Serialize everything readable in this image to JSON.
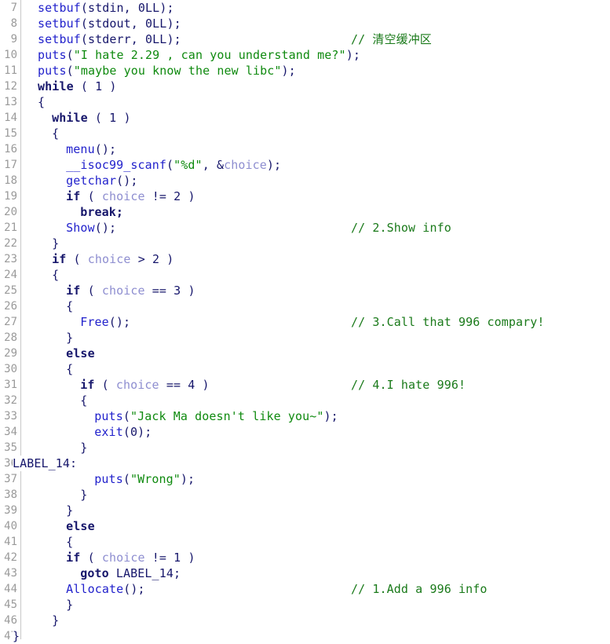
{
  "editor": {
    "kind": "decompiler-pseudocode-view",
    "language": "c",
    "first_line_number": 7,
    "last_line_number": 47,
    "gutter_separator_color": "#c8c8c8",
    "background_color": "#ffffff"
  },
  "colors": {
    "keyword": "#16166b",
    "function": "#2222cc",
    "variable": "#8e8ed0",
    "string": "#0f8a0f",
    "comment": "#1a7a1a",
    "line_number": "#9a9a9a",
    "punctuation": "#16166b"
  },
  "lines": [
    {
      "no": "7",
      "indent": 2,
      "comment": "",
      "tokens": [
        {
          "t": "setbuf",
          "c": "fn"
        },
        {
          "t": "(",
          "c": "punc"
        },
        {
          "t": "stdin",
          "c": "plain"
        },
        {
          "t": ", ",
          "c": "punc"
        },
        {
          "t": "0LL",
          "c": "num"
        },
        {
          "t": ");",
          "c": "punc"
        }
      ]
    },
    {
      "no": "8",
      "indent": 2,
      "comment": "",
      "tokens": [
        {
          "t": "setbuf",
          "c": "fn"
        },
        {
          "t": "(",
          "c": "punc"
        },
        {
          "t": "stdout",
          "c": "plain"
        },
        {
          "t": ", ",
          "c": "punc"
        },
        {
          "t": "0LL",
          "c": "num"
        },
        {
          "t": ");",
          "c": "punc"
        }
      ]
    },
    {
      "no": "9",
      "indent": 2,
      "comment": "// 清空缓冲区",
      "tokens": [
        {
          "t": "setbuf",
          "c": "fn"
        },
        {
          "t": "(",
          "c": "punc"
        },
        {
          "t": "stderr",
          "c": "plain"
        },
        {
          "t": ", ",
          "c": "punc"
        },
        {
          "t": "0LL",
          "c": "num"
        },
        {
          "t": ");",
          "c": "punc"
        }
      ]
    },
    {
      "no": "10",
      "indent": 2,
      "comment": "",
      "tokens": [
        {
          "t": "puts",
          "c": "fn"
        },
        {
          "t": "(",
          "c": "punc"
        },
        {
          "t": "\"I hate 2.29 , can you understand me?\"",
          "c": "str"
        },
        {
          "t": ");",
          "c": "punc"
        }
      ]
    },
    {
      "no": "11",
      "indent": 2,
      "comment": "",
      "tokens": [
        {
          "t": "puts",
          "c": "fn"
        },
        {
          "t": "(",
          "c": "punc"
        },
        {
          "t": "\"maybe you know the new libc\"",
          "c": "str"
        },
        {
          "t": ");",
          "c": "punc"
        }
      ]
    },
    {
      "no": "12",
      "indent": 2,
      "comment": "",
      "tokens": [
        {
          "t": "while",
          "c": "kw"
        },
        {
          "t": " ( ",
          "c": "punc"
        },
        {
          "t": "1",
          "c": "num"
        },
        {
          "t": " )",
          "c": "punc"
        }
      ]
    },
    {
      "no": "13",
      "indent": 2,
      "comment": "",
      "tokens": [
        {
          "t": "{",
          "c": "punc"
        }
      ]
    },
    {
      "no": "14",
      "indent": 4,
      "comment": "",
      "tokens": [
        {
          "t": "while",
          "c": "kw"
        },
        {
          "t": " ( ",
          "c": "punc"
        },
        {
          "t": "1",
          "c": "num"
        },
        {
          "t": " )",
          "c": "punc"
        }
      ]
    },
    {
      "no": "15",
      "indent": 4,
      "comment": "",
      "tokens": [
        {
          "t": "{",
          "c": "punc"
        }
      ]
    },
    {
      "no": "16",
      "indent": 6,
      "comment": "",
      "tokens": [
        {
          "t": "menu",
          "c": "fn"
        },
        {
          "t": "();",
          "c": "punc"
        }
      ]
    },
    {
      "no": "17",
      "indent": 6,
      "comment": "",
      "tokens": [
        {
          "t": "__isoc99_scanf",
          "c": "fn"
        },
        {
          "t": "(",
          "c": "punc"
        },
        {
          "t": "\"%d\"",
          "c": "str"
        },
        {
          "t": ", &",
          "c": "punc"
        },
        {
          "t": "choice",
          "c": "var"
        },
        {
          "t": ");",
          "c": "punc"
        }
      ]
    },
    {
      "no": "18",
      "indent": 6,
      "comment": "",
      "tokens": [
        {
          "t": "getchar",
          "c": "fn"
        },
        {
          "t": "();",
          "c": "punc"
        }
      ]
    },
    {
      "no": "19",
      "indent": 6,
      "comment": "",
      "tokens": [
        {
          "t": "if",
          "c": "kw"
        },
        {
          "t": " ( ",
          "c": "punc"
        },
        {
          "t": "choice",
          "c": "var"
        },
        {
          "t": " != ",
          "c": "punc"
        },
        {
          "t": "2",
          "c": "num"
        },
        {
          "t": " )",
          "c": "punc"
        }
      ]
    },
    {
      "no": "20",
      "indent": 8,
      "comment": "",
      "tokens": [
        {
          "t": "break;",
          "c": "kw"
        }
      ]
    },
    {
      "no": "21",
      "indent": 6,
      "comment": "// 2.Show info",
      "tokens": [
        {
          "t": "Show",
          "c": "fn"
        },
        {
          "t": "();",
          "c": "punc"
        }
      ]
    },
    {
      "no": "22",
      "indent": 4,
      "comment": "",
      "tokens": [
        {
          "t": "}",
          "c": "punc"
        }
      ]
    },
    {
      "no": "23",
      "indent": 4,
      "comment": "",
      "tokens": [
        {
          "t": "if",
          "c": "kw"
        },
        {
          "t": " ( ",
          "c": "punc"
        },
        {
          "t": "choice",
          "c": "var"
        },
        {
          "t": " > ",
          "c": "punc"
        },
        {
          "t": "2",
          "c": "num"
        },
        {
          "t": " )",
          "c": "punc"
        }
      ]
    },
    {
      "no": "24",
      "indent": 4,
      "comment": "",
      "tokens": [
        {
          "t": "{",
          "c": "punc"
        }
      ]
    },
    {
      "no": "25",
      "indent": 6,
      "comment": "",
      "tokens": [
        {
          "t": "if",
          "c": "kw"
        },
        {
          "t": " ( ",
          "c": "punc"
        },
        {
          "t": "choice",
          "c": "var"
        },
        {
          "t": " == ",
          "c": "punc"
        },
        {
          "t": "3",
          "c": "num"
        },
        {
          "t": " )",
          "c": "punc"
        }
      ]
    },
    {
      "no": "26",
      "indent": 6,
      "comment": "",
      "tokens": [
        {
          "t": "{",
          "c": "punc"
        }
      ]
    },
    {
      "no": "27",
      "indent": 8,
      "comment": "// 3.Call that 996 compary!",
      "tokens": [
        {
          "t": "Free",
          "c": "fn"
        },
        {
          "t": "();",
          "c": "punc"
        }
      ]
    },
    {
      "no": "28",
      "indent": 6,
      "comment": "",
      "tokens": [
        {
          "t": "}",
          "c": "punc"
        }
      ]
    },
    {
      "no": "29",
      "indent": 6,
      "comment": "",
      "tokens": [
        {
          "t": "else",
          "c": "kw"
        }
      ]
    },
    {
      "no": "30",
      "indent": 6,
      "comment": "",
      "tokens": [
        {
          "t": "{",
          "c": "punc"
        }
      ]
    },
    {
      "no": "31",
      "indent": 8,
      "comment": "// 4.I hate 996!",
      "tokens": [
        {
          "t": "if",
          "c": "kw"
        },
        {
          "t": " ( ",
          "c": "punc"
        },
        {
          "t": "choice",
          "c": "var"
        },
        {
          "t": " == ",
          "c": "punc"
        },
        {
          "t": "4",
          "c": "num"
        },
        {
          "t": " )",
          "c": "punc"
        }
      ]
    },
    {
      "no": "32",
      "indent": 8,
      "comment": "",
      "tokens": [
        {
          "t": "{",
          "c": "punc"
        }
      ]
    },
    {
      "no": "33",
      "indent": 10,
      "comment": "",
      "tokens": [
        {
          "t": "puts",
          "c": "fn"
        },
        {
          "t": "(",
          "c": "punc"
        },
        {
          "t": "\"Jack Ma doesn't like you~\"",
          "c": "str"
        },
        {
          "t": ");",
          "c": "punc"
        }
      ]
    },
    {
      "no": "34",
      "indent": 10,
      "comment": "",
      "tokens": [
        {
          "t": "exit",
          "c": "fn"
        },
        {
          "t": "(",
          "c": "punc"
        },
        {
          "t": "0",
          "c": "num"
        },
        {
          "t": ");",
          "c": "punc"
        }
      ]
    },
    {
      "no": "35",
      "indent": 8,
      "comment": "",
      "tokens": [
        {
          "t": "}",
          "c": "punc"
        }
      ]
    },
    {
      "no": "36",
      "indent": 0,
      "label": true,
      "comment": "",
      "tokens": [
        {
          "t": "LABEL_14:",
          "c": "lbl"
        }
      ]
    },
    {
      "no": "37",
      "indent": 10,
      "comment": "",
      "tokens": [
        {
          "t": "puts",
          "c": "fn"
        },
        {
          "t": "(",
          "c": "punc"
        },
        {
          "t": "\"Wrong\"",
          "c": "str"
        },
        {
          "t": ");",
          "c": "punc"
        }
      ]
    },
    {
      "no": "38",
      "indent": 8,
      "comment": "",
      "tokens": [
        {
          "t": "}",
          "c": "punc"
        }
      ]
    },
    {
      "no": "39",
      "indent": 6,
      "comment": "",
      "tokens": [
        {
          "t": "}",
          "c": "punc"
        }
      ]
    },
    {
      "no": "40",
      "indent": 6,
      "comment": "",
      "tokens": [
        {
          "t": "else",
          "c": "kw"
        }
      ]
    },
    {
      "no": "41",
      "indent": 6,
      "comment": "",
      "tokens": [
        {
          "t": "{",
          "c": "punc"
        }
      ]
    },
    {
      "no": "42",
      "indent": 6,
      "comment": "",
      "tokens": [
        {
          "t": "if",
          "c": "kw"
        },
        {
          "t": " ( ",
          "c": "punc"
        },
        {
          "t": "choice",
          "c": "var"
        },
        {
          "t": " != ",
          "c": "punc"
        },
        {
          "t": "1",
          "c": "num"
        },
        {
          "t": " )",
          "c": "punc"
        }
      ]
    },
    {
      "no": "43",
      "indent": 8,
      "comment": "",
      "tokens": [
        {
          "t": "goto",
          "c": "kw"
        },
        {
          "t": " ",
          "c": "punc"
        },
        {
          "t": "LABEL_14;",
          "c": "lbl"
        }
      ]
    },
    {
      "no": "44",
      "indent": 6,
      "comment": "// 1.Add a 996 info",
      "tokens": [
        {
          "t": "Allocate",
          "c": "fn"
        },
        {
          "t": "();",
          "c": "punc"
        }
      ]
    },
    {
      "no": "45",
      "indent": 6,
      "comment": "",
      "tokens": [
        {
          "t": "}",
          "c": "punc"
        }
      ]
    },
    {
      "no": "46",
      "indent": 4,
      "comment": "",
      "tokens": [
        {
          "t": "}",
          "c": "punc"
        }
      ]
    },
    {
      "no": "47",
      "indent": 0,
      "label": true,
      "comment": "",
      "tokens": [
        {
          "t": "}",
          "c": "punc"
        }
      ]
    }
  ]
}
